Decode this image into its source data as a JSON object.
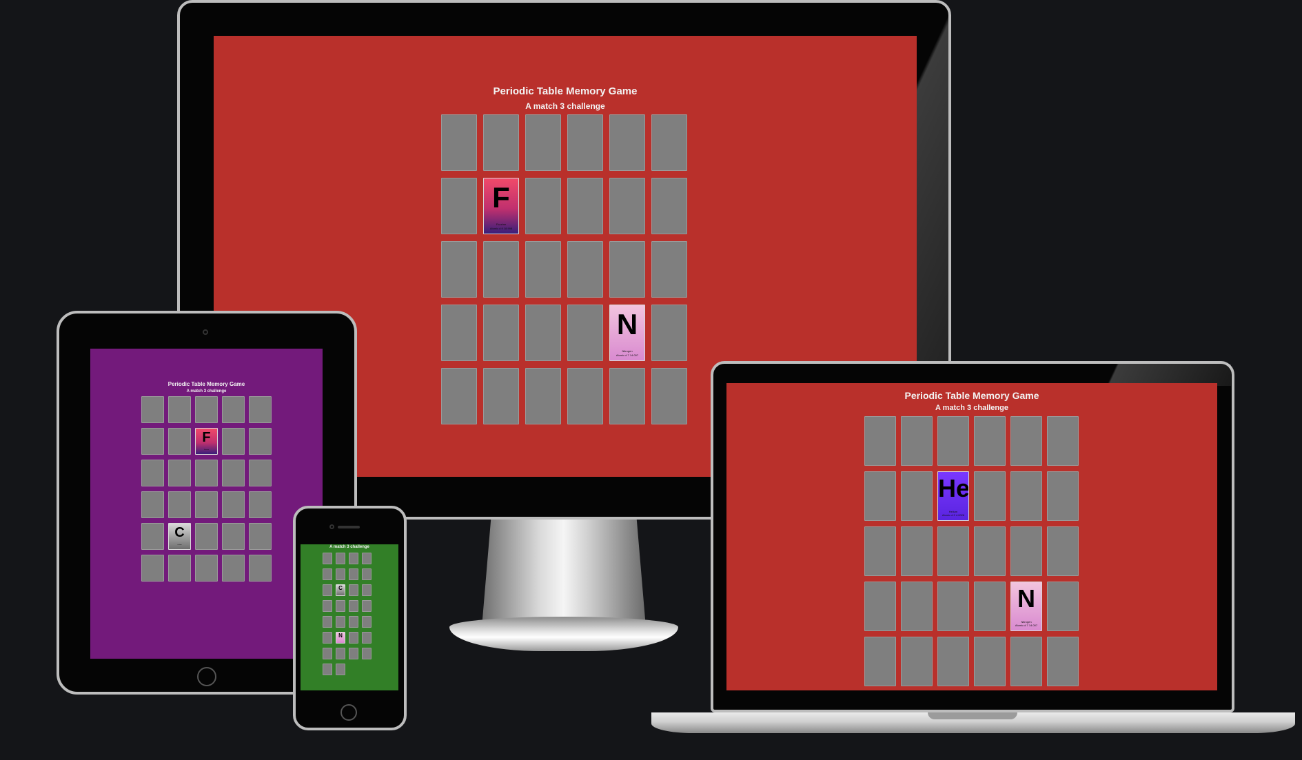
{
  "game": {
    "title": "Periodic Table Memory Game",
    "subtitle": "A match 3 challenge"
  },
  "devices": {
    "desktop": {
      "screen_color": "#b9302b",
      "columns": 6,
      "rows": 5,
      "revealed": [
        {
          "row": 1,
          "col": 1,
          "symbol": "F",
          "name": "Fluorine",
          "detail": "Atomic # 9 18.998",
          "gradient": "pink-purple"
        },
        {
          "row": 3,
          "col": 4,
          "symbol": "N",
          "name": "Nitrogen",
          "detail": "Atomic # 7 14.007",
          "gradient": "pink"
        }
      ]
    },
    "tablet": {
      "screen_color": "#731a7b",
      "columns": 5,
      "rows": 6,
      "revealed": [
        {
          "row": 1,
          "col": 2,
          "symbol": "F",
          "name": "Fluorine",
          "detail": "",
          "gradient": "pink-purple"
        },
        {
          "row": 4,
          "col": 1,
          "symbol": "C",
          "name": "Carbon",
          "detail": "",
          "gradient": "silver"
        }
      ]
    },
    "phone": {
      "screen_color": "#327f27",
      "subtitle": "A match 3 challenge",
      "columns": 4,
      "rows": 8,
      "last_row_count": 2,
      "revealed": [
        {
          "row": 2,
          "col": 1,
          "symbol": "C",
          "name": "",
          "detail": "",
          "gradient": "silver"
        },
        {
          "row": 5,
          "col": 1,
          "symbol": "N",
          "name": "",
          "detail": "",
          "gradient": "pink"
        }
      ]
    },
    "laptop": {
      "screen_color": "#b9302b",
      "columns": 6,
      "rows": 5,
      "revealed": [
        {
          "row": 1,
          "col": 2,
          "symbol": "He",
          "name": "Helium",
          "detail": "Atomic # 2 4.0026",
          "gradient": "violet"
        },
        {
          "row": 3,
          "col": 4,
          "symbol": "N",
          "name": "Nitrogen",
          "detail": "Atomic # 7 14.007",
          "gradient": "pink"
        }
      ]
    }
  },
  "gradients": {
    "pink-purple": "#ec4a6a",
    "pink": "#e6a3d3",
    "violet": "#6b2df0",
    "silver": "#9a9a9a"
  },
  "card_back_color": "#7f7f7f"
}
